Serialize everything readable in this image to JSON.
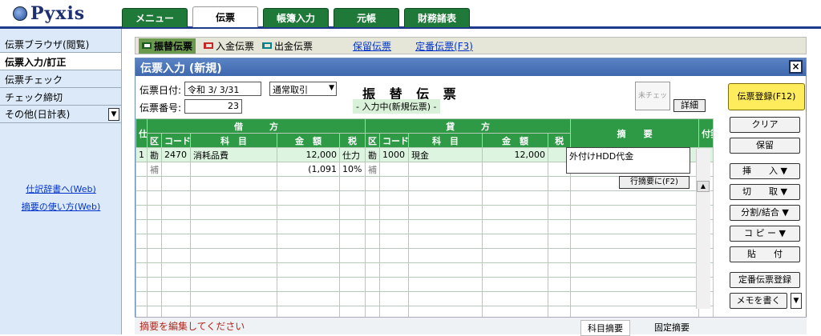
{
  "app": {
    "logo": "Pyxis"
  },
  "tabs": [
    "メニュー",
    "伝票",
    "帳簿入力",
    "元帳",
    "財務諸表"
  ],
  "sidebar": {
    "items": [
      "伝票ブラウザ(閲覧)",
      "伝票入力/訂正",
      "伝票チェック",
      "チェック締切",
      "その他(日計表)"
    ],
    "links": [
      "仕訳辞書へ(Web)",
      "摘要の使い方(Web)"
    ]
  },
  "slipbar": {
    "types": [
      "振替伝票",
      "入金伝票",
      "出金伝票"
    ],
    "links": [
      "保留伝票",
      "定番伝票(F3)"
    ]
  },
  "panel": {
    "title": "伝票入力 (新規)",
    "date_label": "伝票日付:",
    "date_value": "令和 3/ 3/31",
    "txn_type": "通常取引",
    "number_label": "伝票番号:",
    "number_value": "23",
    "slip_title": "振 替 伝 票",
    "status": "- 入力中(新規伝票) -",
    "unchecked": "未チェック",
    "detail": "詳細"
  },
  "grid": {
    "header_top": [
      "仕訳",
      "借　　　方",
      "貸　　　方",
      "摘　　要",
      "付箋"
    ],
    "header_sub": [
      "区",
      "コード",
      "科　目",
      "金　額",
      "税",
      "区",
      "コード",
      "科　目",
      "金　額",
      "税"
    ],
    "rows": [
      {
        "no": "1",
        "d_kbn": "勘",
        "d_code": "2470",
        "d_name": "消耗品費",
        "d_amount": "12,000",
        "d_tax": "仕力",
        "c_kbn": "勘",
        "c_code": "1000",
        "c_name": "現金",
        "c_amount": "12,000",
        "c_tax": ""
      },
      {
        "no": "",
        "d_kbn": "補",
        "d_code": "",
        "d_name": "",
        "d_amount": "(1,091",
        "d_tax": "10%",
        "c_kbn": "補",
        "c_code": "",
        "c_name": "",
        "c_amount": "",
        "c_tax": ""
      }
    ],
    "memo": "外付けHDD代金",
    "row_memo_button": "行摘要に(F2)"
  },
  "right_buttons": {
    "register": "伝票登録(F12)",
    "clear": "クリア",
    "hold": "保留",
    "insert": "挿　　入 ▼",
    "cut": "切　　取 ▼",
    "split": "分割/結合 ▼",
    "copy": "コ ピ ー ▼",
    "paste": "貼　　付",
    "fixed_register": "定番伝票登録",
    "memo": "メモを書く"
  },
  "bottom": {
    "message": "摘要を編集してください",
    "tab1": "科目摘要",
    "tab2": "固定摘要"
  }
}
